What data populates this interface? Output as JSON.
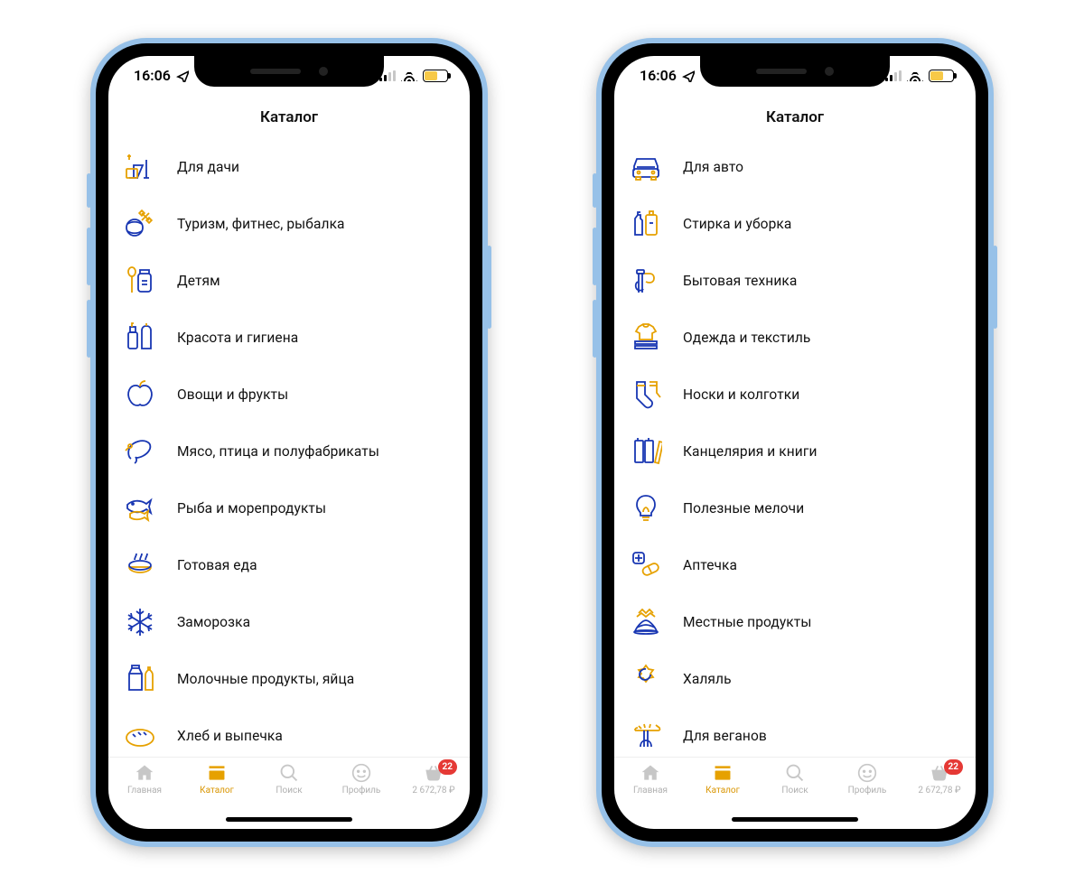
{
  "status": {
    "time": "16:06",
    "icons": [
      "location-arrow",
      "signal",
      "wifi",
      "battery-low"
    ]
  },
  "header": {
    "title": "Каталог"
  },
  "tabbar": {
    "items": [
      {
        "id": "home",
        "label": "Главная",
        "icon": "home-icon",
        "active": false
      },
      {
        "id": "catalog",
        "label": "Каталог",
        "icon": "catalog-icon",
        "active": true
      },
      {
        "id": "search",
        "label": "Поиск",
        "icon": "search-icon",
        "active": false
      },
      {
        "id": "profile",
        "label": "Профиль",
        "icon": "profile-icon",
        "active": false
      },
      {
        "id": "cart",
        "label": "2 672,78 ₽",
        "icon": "basket-icon",
        "active": false,
        "badge": "22"
      }
    ]
  },
  "phones": [
    {
      "categories": [
        {
          "icon": "garden-icon",
          "label": "Для дачи"
        },
        {
          "icon": "sport-icon",
          "label": "Туризм, фитнес, рыбалка"
        },
        {
          "icon": "kids-icon",
          "label": "Детям"
        },
        {
          "icon": "beauty-icon",
          "label": "Красота и гигиена"
        },
        {
          "icon": "apple-icon",
          "label": "Овощи и фрукты"
        },
        {
          "icon": "meat-icon",
          "label": "Мясо, птица и полуфабрикаты"
        },
        {
          "icon": "fish-icon",
          "label": "Рыба и морепродукты"
        },
        {
          "icon": "readymeal-icon",
          "label": "Готовая еда"
        },
        {
          "icon": "frozen-icon",
          "label": "Заморозка"
        },
        {
          "icon": "dairy-icon",
          "label": "Молочные продукты, яйца"
        },
        {
          "icon": "bread-icon",
          "label": "Хлеб и выпечка"
        }
      ]
    },
    {
      "categories": [
        {
          "icon": "car-icon",
          "label": "Для авто"
        },
        {
          "icon": "cleaning-icon",
          "label": "Стирка и уборка"
        },
        {
          "icon": "appliance-icon",
          "label": "Бытовая техника"
        },
        {
          "icon": "clothes-icon",
          "label": "Одежда и текстиль"
        },
        {
          "icon": "socks-icon",
          "label": "Носки и колготки"
        },
        {
          "icon": "stationery-icon",
          "label": "Канцелярия и книги"
        },
        {
          "icon": "bulb-icon",
          "label": "Полезные мелочи"
        },
        {
          "icon": "pharmacy-icon",
          "label": "Аптечка"
        },
        {
          "icon": "local-icon",
          "label": "Местные продукты"
        },
        {
          "icon": "halal-icon",
          "label": "Халяль"
        },
        {
          "icon": "vegan-icon",
          "label": "Для веганов"
        }
      ]
    }
  ],
  "colors": {
    "blue": "#1836b2",
    "gold": "#e6a100",
    "badge": "#e53935"
  }
}
